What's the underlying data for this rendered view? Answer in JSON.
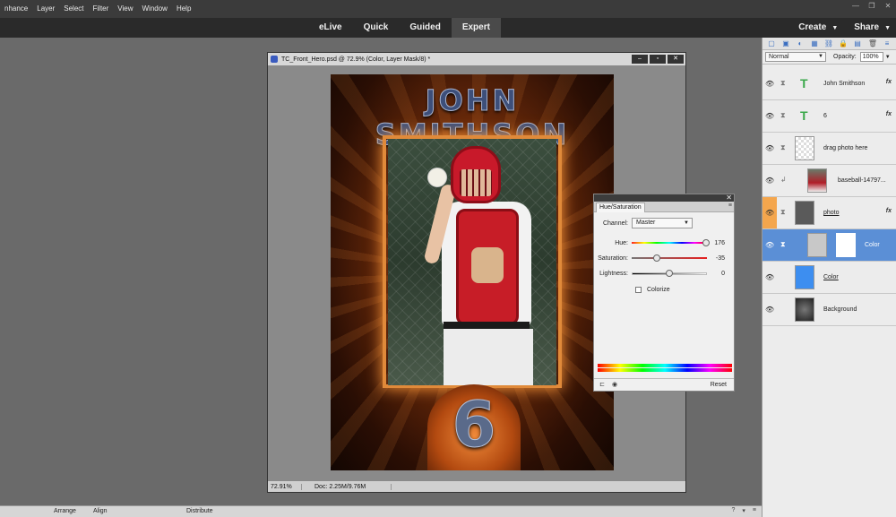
{
  "menu": {
    "items": [
      "nhance",
      "Layer",
      "Select",
      "Filter",
      "View",
      "Window",
      "Help"
    ]
  },
  "modes": {
    "elive": "eLive",
    "quick": "Quick",
    "guided": "Guided",
    "expert": "Expert"
  },
  "header_right": {
    "create": "Create",
    "share": "Share"
  },
  "document": {
    "title": "TC_Front_Hero.psd @ 72.9% (Color, Layer Mask/8) *",
    "zoom": "72.91%",
    "doc_size": "Doc: 2.25M/9.76M",
    "artwork_name": "JOHN SMITHSON",
    "artwork_number": "6"
  },
  "huesat": {
    "tab": "Hue/Saturation",
    "channel_label": "Channel:",
    "channel_value": "Master",
    "hue_label": "Hue:",
    "hue_value": "176",
    "hue_fraction": 0.99,
    "sat_label": "Saturation:",
    "sat_value": "-35",
    "sat_fraction": 0.33,
    "light_label": "Lightness:",
    "light_value": "0",
    "light_fraction": 0.5,
    "colorize_label": "Colorize",
    "reset_label": "Reset"
  },
  "layers_panel": {
    "blend_mode": "Normal",
    "opacity_label": "Opacity:",
    "opacity_value": "100%",
    "layers": [
      {
        "label": "John Smithson",
        "kind": "type",
        "fx": "fx"
      },
      {
        "label": "6",
        "kind": "type",
        "fx": "fx"
      },
      {
        "label": "drag photo here",
        "kind": "empty",
        "fx": ""
      },
      {
        "label": "baseball-14797...",
        "kind": "photo",
        "fx": ""
      },
      {
        "label": "photo",
        "kind": "gray",
        "fx": "fx"
      },
      {
        "label": "Color",
        "kind": "adjust",
        "fx": ""
      },
      {
        "label": "Color",
        "kind": "blue",
        "fx": ""
      },
      {
        "label": "Background",
        "kind": "bg",
        "fx": ""
      }
    ]
  },
  "bottombar": {
    "arrange": "Arrange",
    "align": "Align",
    "distribute": "Distribute"
  }
}
